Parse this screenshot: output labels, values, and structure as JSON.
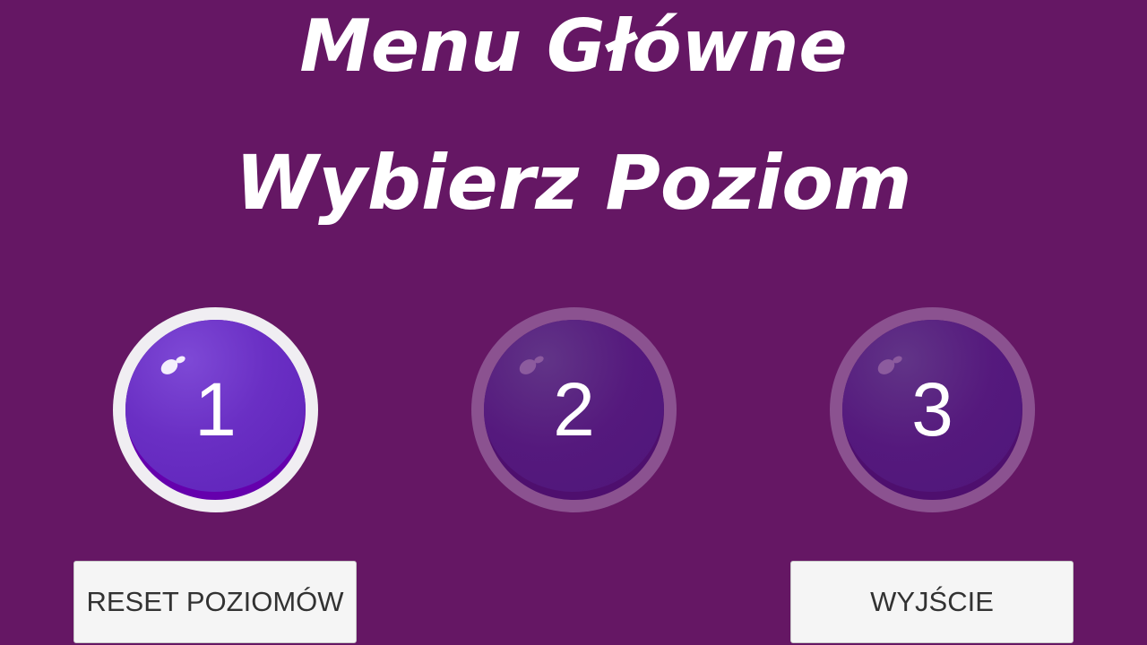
{
  "header": {
    "title": "Menu Główne",
    "subtitle": "Wybierz Poziom"
  },
  "levels": [
    {
      "label": "1",
      "state": "unlocked"
    },
    {
      "label": "2",
      "state": "locked"
    },
    {
      "label": "3",
      "state": "locked"
    }
  ],
  "buttons": {
    "reset_label": "RESET POZIOMÓW",
    "exit_label": "WYJŚCIE"
  },
  "colors": {
    "background": "#651764",
    "unlocked_ring": "#f0eef2",
    "unlocked_face": "#6a2fc4",
    "locked_ring": "#8b5290",
    "locked_face": "#55197d",
    "button_bg": "#f5f5f5",
    "button_text": "#323232"
  }
}
